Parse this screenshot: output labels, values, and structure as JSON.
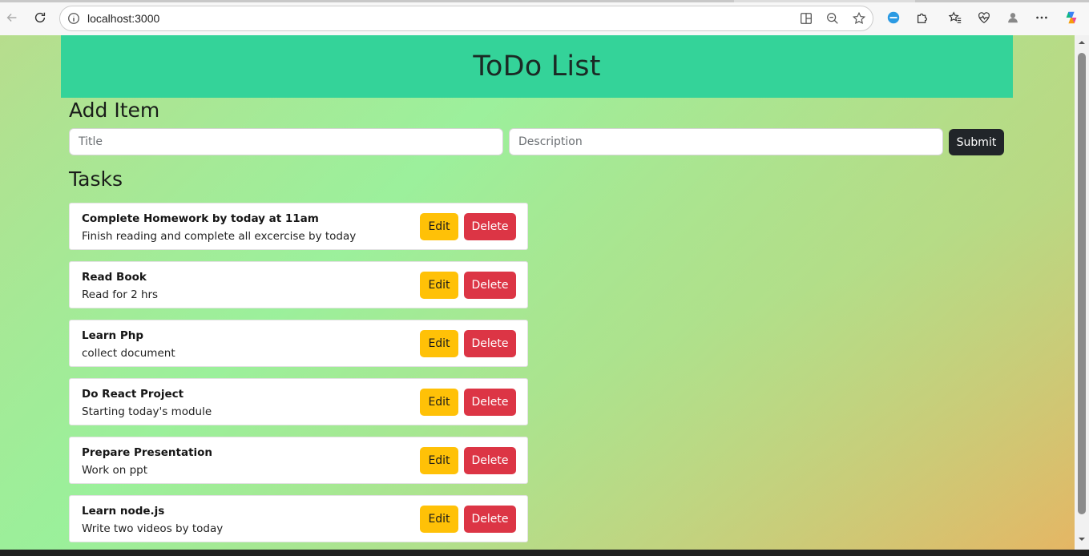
{
  "browser": {
    "url": "localhost:3000",
    "icons": [
      "back-icon",
      "reload-icon",
      "info-icon",
      "split-screen-icon",
      "zoom-icon",
      "favorite-star-icon",
      "copilot-sidebar-icon",
      "extensions-icon",
      "favorites-icon",
      "health-icon",
      "profile-icon",
      "more-icon",
      "copilot-icon"
    ]
  },
  "header": {
    "title": "ToDo List"
  },
  "add_item": {
    "heading": "Add Item",
    "title_placeholder": "Title",
    "title_value": "",
    "description_placeholder": "Description",
    "description_value": "",
    "submit_label": "Submit"
  },
  "tasks": {
    "heading": "Tasks",
    "edit_label": "Edit",
    "delete_label": "Delete",
    "items": [
      {
        "title": "Complete Homework by today at 11am",
        "description": "Finish reading and complete all excercise by today"
      },
      {
        "title": "Read Book",
        "description": "Read for 2 hrs"
      },
      {
        "title": "Learn Php",
        "description": "collect document"
      },
      {
        "title": "Do React Project",
        "description": "Starting today's module"
      },
      {
        "title": "Prepare Presentation",
        "description": "Work on ppt"
      },
      {
        "title": "Learn node.js",
        "description": "Write two videos by today"
      }
    ]
  },
  "colors": {
    "header_bg": "#34d399",
    "edit_button": "#ffc107",
    "delete_button": "#dc3545",
    "submit_button": "#212529"
  }
}
